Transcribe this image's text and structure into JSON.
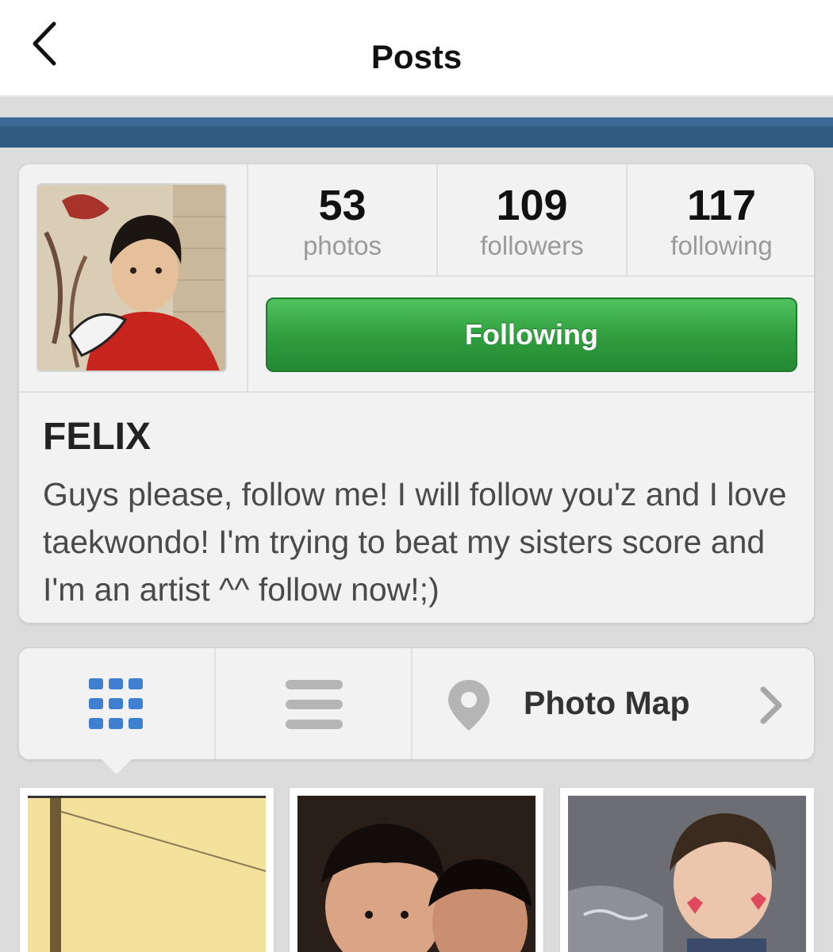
{
  "header": {
    "back_icon": "chevron-left-icon",
    "title": "Posts"
  },
  "profile": {
    "stats": [
      {
        "value": "53",
        "label": "photos"
      },
      {
        "value": "109",
        "label": "followers"
      },
      {
        "value": "117",
        "label": "following"
      }
    ],
    "follow_button": "Following",
    "name": "FELIX",
    "bio": "Guys please, follow me! I will follow you'z and I love taekwondo! I'm trying to beat my sisters score and I'm an artist ^^ follow now!;)"
  },
  "view_switcher": {
    "grid_icon": "grid-icon",
    "list_icon": "list-icon",
    "map_icon": "map-pin-icon",
    "map_label": "Photo Map",
    "chevron_icon": "chevron-right-icon"
  },
  "colors": {
    "accent_blue": "#3f7fcf",
    "follow_green": "#2f9c3e",
    "nav_strip": "#2f5a82"
  }
}
